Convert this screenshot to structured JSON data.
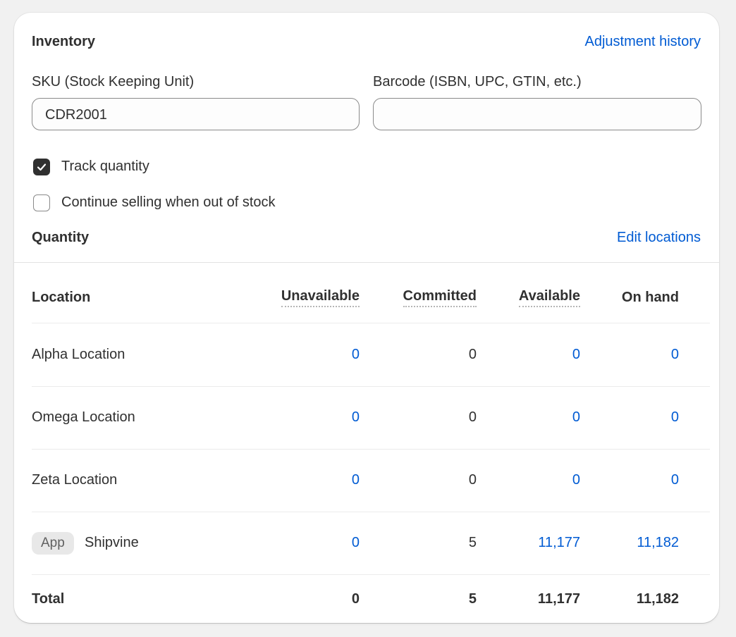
{
  "inventory": {
    "title": "Inventory",
    "adjustment_link": "Adjustment history",
    "sku_label": "SKU (Stock Keeping Unit)",
    "sku_value": "CDR2001",
    "barcode_label": "Barcode (ISBN, UPC, GTIN, etc.)",
    "barcode_value": "",
    "track_quantity": {
      "label": "Track quantity",
      "checked": true
    },
    "continue_selling": {
      "label": "Continue selling when out of stock",
      "checked": false
    }
  },
  "quantity": {
    "title": "Quantity",
    "edit_link": "Edit locations",
    "columns": [
      "Location",
      "Unavailable",
      "Committed",
      "Available",
      "On hand"
    ],
    "rows": [
      {
        "location": "Alpha Location",
        "badge": "",
        "unavailable": "0",
        "committed": "0",
        "available": "0",
        "on_hand": "0"
      },
      {
        "location": "Omega Location",
        "badge": "",
        "unavailable": "0",
        "committed": "0",
        "available": "0",
        "on_hand": "0"
      },
      {
        "location": "Zeta Location",
        "badge": "",
        "unavailable": "0",
        "committed": "0",
        "available": "0",
        "on_hand": "0"
      },
      {
        "location": "Shipvine",
        "badge": "App",
        "unavailable": "0",
        "committed": "5",
        "available": "11,177",
        "on_hand": "11,182"
      }
    ],
    "total": {
      "label": "Total",
      "unavailable": "0",
      "committed": "5",
      "available": "11,177",
      "on_hand": "11,182"
    }
  },
  "colors": {
    "link": "#005bd3",
    "text": "#303030",
    "checkbox_checked": "#303030"
  }
}
